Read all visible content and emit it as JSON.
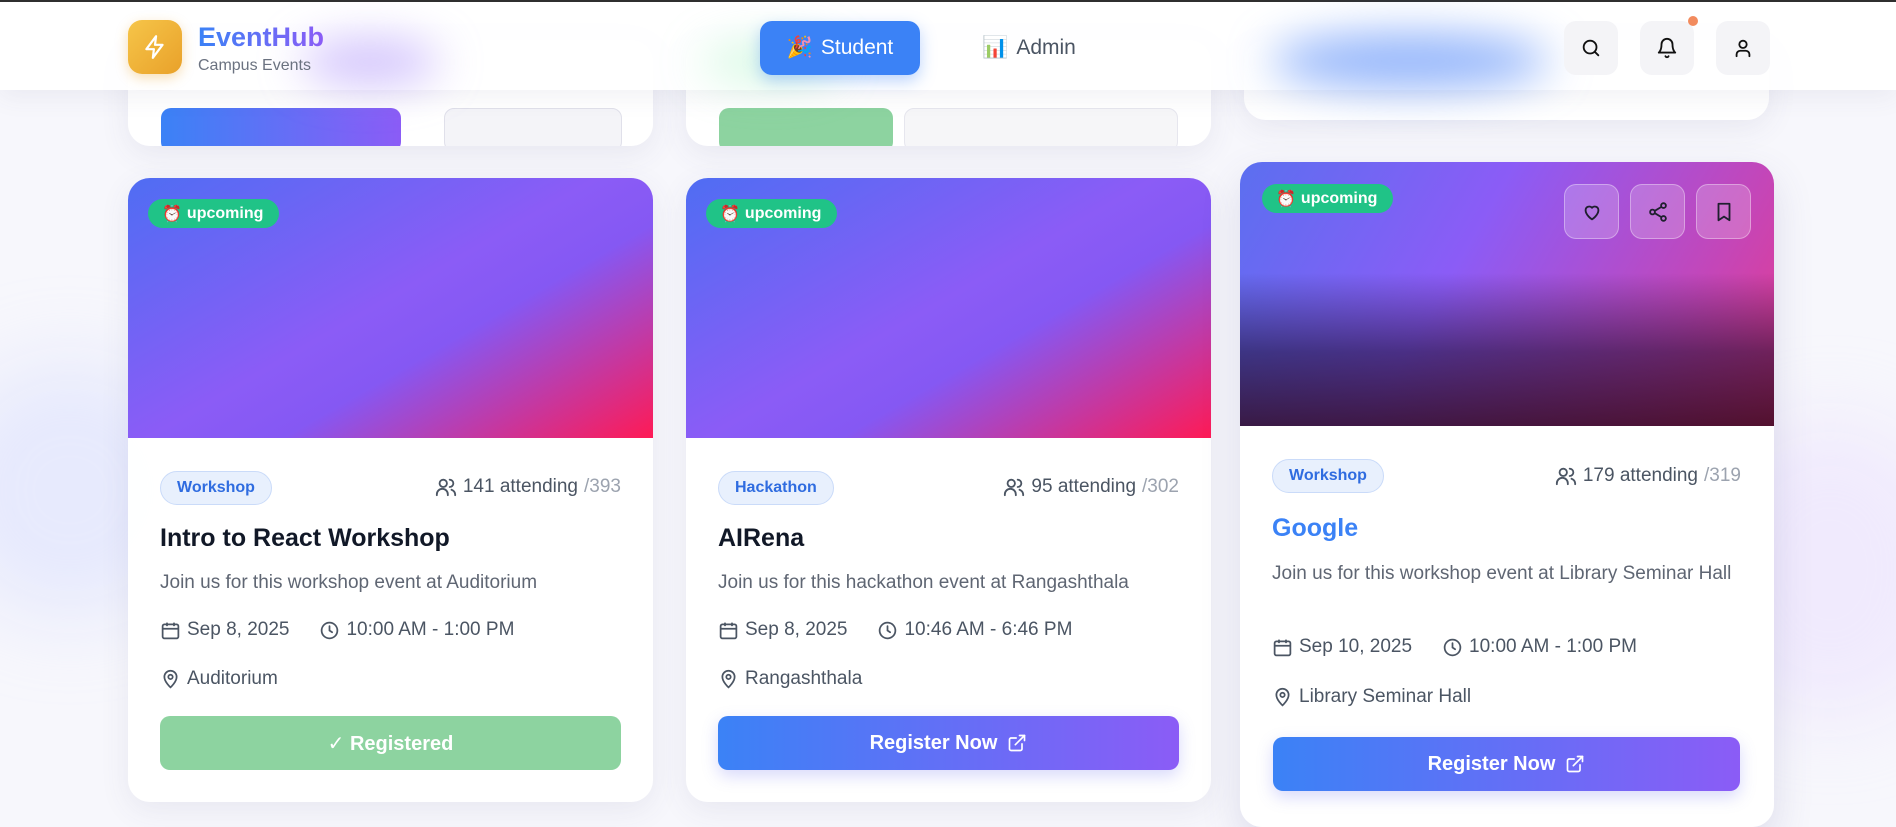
{
  "brand": {
    "title": "EventHub",
    "subtitle": "Campus Events",
    "icon": "lightning-icon"
  },
  "nav": {
    "tabs": [
      {
        "label": "Student",
        "emoji": "🎉",
        "active": true
      },
      {
        "label": "Admin",
        "emoji": "📊",
        "active": false
      }
    ],
    "icons": [
      "search-icon",
      "bell-icon",
      "user-icon"
    ]
  },
  "colors": {
    "primary": "#3b82f6",
    "secondary": "#8b5cf6",
    "status_upcoming": "#20c387",
    "registered": "#8dd3a0",
    "logo": "#f6c549"
  },
  "events": [
    {
      "status": "upcoming",
      "status_emoji": "⏰",
      "category": "Workshop",
      "attending": "141 attending",
      "capacity": "/393",
      "title": "Intro to React Workshop",
      "description": "Join us for this workshop event at Auditorium",
      "date": "Sep 8, 2025",
      "time": "10:00 AM - 1:00 PM",
      "location": "Auditorium",
      "button": "✓ Registered"
    },
    {
      "status": "upcoming",
      "status_emoji": "⏰",
      "category": "Hackathon",
      "attending": "95 attending",
      "capacity": "/302",
      "title": "AIRena",
      "description": "Join us for this hackathon event at Rangashthala",
      "date": "Sep 8, 2025",
      "time": "10:46 AM - 6:46 PM",
      "location": "Rangashthala",
      "button": "Register Now"
    },
    {
      "status": "upcoming",
      "status_emoji": "⏰",
      "category": "Workshop",
      "attending": "179 attending",
      "capacity": "/319",
      "title": "Google",
      "description": "Join us for this workshop event at Library Seminar Hall",
      "date": "Sep 10, 2025",
      "time": "10:00 AM - 1:00 PM",
      "location": "Library Seminar Hall",
      "button": "Register Now"
    }
  ]
}
